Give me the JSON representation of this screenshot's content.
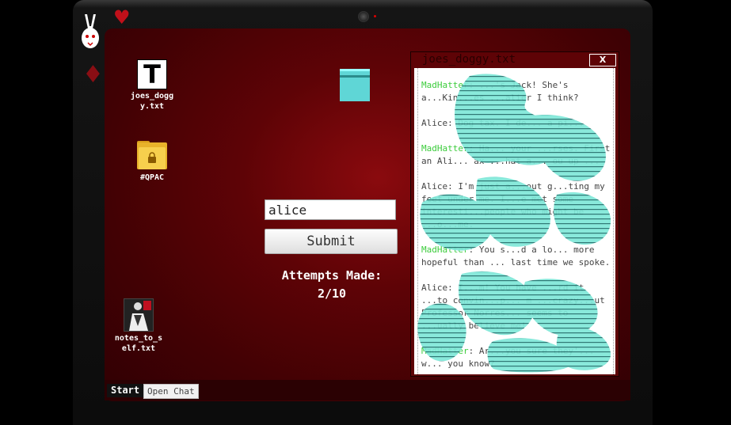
{
  "desktop": {
    "icons": [
      {
        "id": "txt",
        "label": "joes_doggy.txt",
        "glyph": "T"
      },
      {
        "id": "folder",
        "label": "#QPAC"
      },
      {
        "id": "notes",
        "label": "notes_to_self.txt"
      }
    ]
  },
  "login": {
    "password_value": "alice",
    "submit_label": "Submit",
    "attempts_label": "Attempts Made:",
    "attempts_count": "2/10"
  },
  "taskbar": {
    "start_label": "Start",
    "chat_label": "Open Chat"
  },
  "window": {
    "title": "joes_doggy.txt",
    "close_label": "X",
    "messages": [
      {
        "speaker": "MadHatter",
        "text": "...'s Jack! She's a...Kin...es ...alier I think?"
      },
      {
        "speaker": "Alice",
        "text": "Dog tax. I de... a pi..."
      },
      {
        "speaker": "MadHatter",
        "text": "Ha... your ...rses. First an Ali... ax ...hat a... ou up ..."
      },
      {
        "speaker": "Alice",
        "text": "I'm just a...out g...ting my feet under me. I...e met some interesti...people who might be ...o...me."
      },
      {
        "speaker": "MadHatter",
        "text": "You s...d a lo... more hopeful than ... last time we spoke."
      },
      {
        "speaker": "Alice",
        "text": "I...m! You have ...rd it ...to convin...p... m ...crazy...ut Professor Norres... seems to ...ually believe me!"
      },
      {
        "speaker": "MadHatter",
        "text": "Ar...you sure they'... w... you know?"
      }
    ]
  },
  "colors": {
    "mad_hatter": "#3ccc3c",
    "jack": "#2b3bd1",
    "screen_bg": "#5e0306",
    "noise": "#7fe8d8"
  }
}
